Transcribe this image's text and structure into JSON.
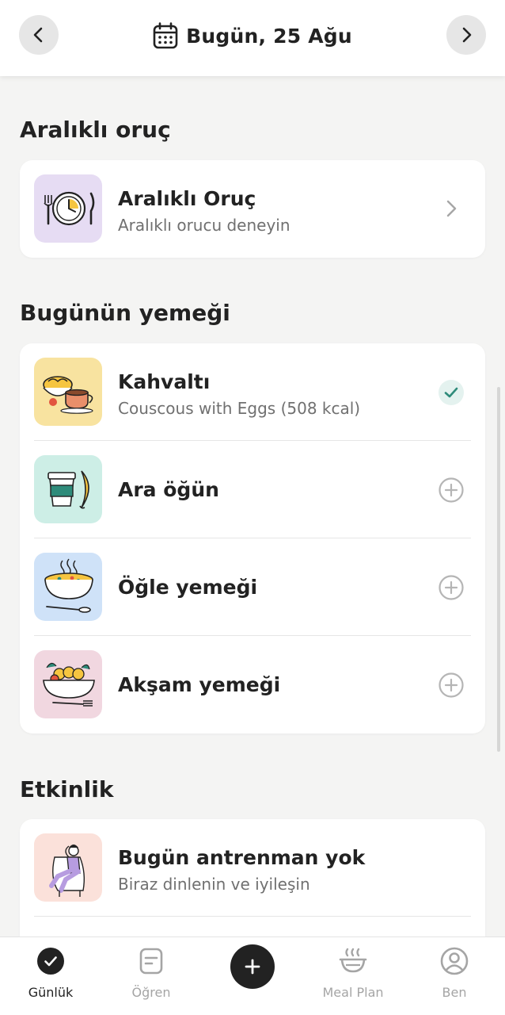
{
  "header": {
    "date_label": "Bugün, 25 Ağu",
    "prev_icon": "chevron-left-icon",
    "next_icon": "chevron-right-icon",
    "calendar_icon": "calendar-icon"
  },
  "fasting": {
    "section_title": "Aralıklı oruç",
    "card": {
      "title": "Aralıklı Oruç",
      "subtitle": "Aralıklı orucu deneyin",
      "icon": "clock-plate-icon",
      "thumb_color": "#e6dcf3"
    }
  },
  "meals": {
    "section_title": "Bugünün yemeği",
    "items": [
      {
        "title": "Kahvaltı",
        "subtitle": "Couscous with Eggs (508 kcal)",
        "status": "check",
        "thumb_color": "#f8e3a0",
        "icon": "breakfast-icon"
      },
      {
        "title": "Ara öğün",
        "subtitle": "",
        "status": "add",
        "thumb_color": "#cdeee6",
        "icon": "snack-icon"
      },
      {
        "title": "Öğle yemeği",
        "subtitle": "",
        "status": "add",
        "thumb_color": "#cfe2f8",
        "icon": "soup-icon"
      },
      {
        "title": "Akşam yemeği",
        "subtitle": "",
        "status": "add",
        "thumb_color": "#f1d7e0",
        "icon": "pasta-icon"
      }
    ]
  },
  "activity": {
    "section_title": "Etkinlik",
    "card": {
      "title": "Bugün antrenman yok",
      "subtitle": "Biraz dinlenin ve iyileşin",
      "thumb_color": "#fbe1da",
      "icon": "resting-person-icon"
    }
  },
  "tabbar": {
    "tabs": [
      {
        "label": "Günlük",
        "icon": "check-circle-icon",
        "active": true
      },
      {
        "label": "Öğren",
        "icon": "document-icon",
        "active": false
      },
      {
        "label": "Meal Plan",
        "icon": "bowl-icon",
        "active": false
      },
      {
        "label": "Ben",
        "icon": "profile-icon",
        "active": false
      }
    ],
    "add_icon": "plus-icon"
  },
  "colors": {
    "accent_check": "#2e8b7a",
    "background": "#f4f4f3",
    "text_primary": "#222222",
    "text_secondary": "#707070"
  }
}
